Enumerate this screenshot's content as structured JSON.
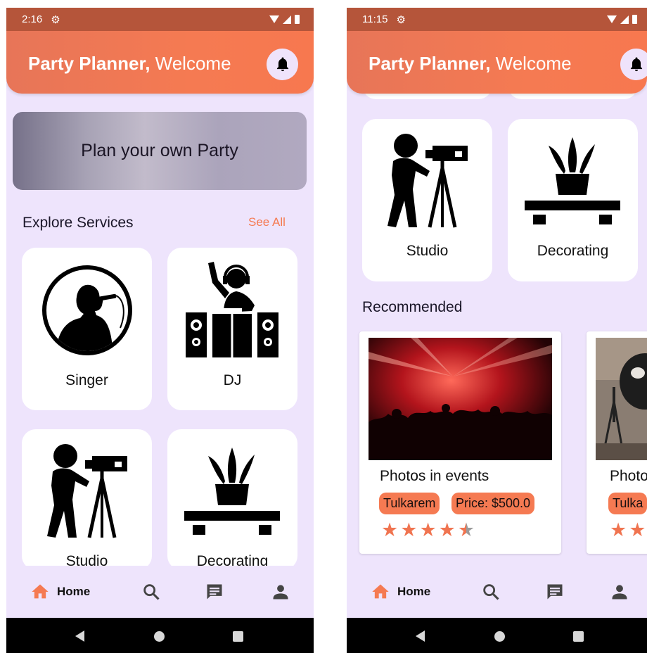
{
  "left": {
    "status": {
      "time": "2:16"
    },
    "header": {
      "app_name": "Party Planner,",
      "welcome": "Welcome"
    },
    "banner": {
      "text": "Plan your own Party"
    },
    "explore": {
      "title": "Explore Services",
      "see_all": "See All"
    },
    "services": [
      {
        "label": "Singer",
        "icon": "singer-icon"
      },
      {
        "label": "DJ",
        "icon": "dj-icon"
      },
      {
        "label": "Studio",
        "icon": "camera-tripod-icon"
      },
      {
        "label": "Decorating",
        "icon": "plant-decor-icon"
      }
    ],
    "nav": {
      "home": "Home"
    }
  },
  "right": {
    "status": {
      "time": "11:15"
    },
    "header": {
      "app_name": "Party Planner,",
      "welcome": "Welcome"
    },
    "services": [
      {
        "label": "Studio",
        "icon": "camera-tripod-icon"
      },
      {
        "label": "Decorating",
        "icon": "plant-decor-icon"
      }
    ],
    "recommended": {
      "title": "Recommended",
      "items": [
        {
          "title": "Photos in events",
          "location": "Tulkarem",
          "price": "Price: $500.0",
          "rating": 4.5
        },
        {
          "title": "Photo",
          "location": "Tulka",
          "price": "",
          "rating": 2
        }
      ]
    },
    "nav": {
      "home": "Home"
    }
  },
  "colors": {
    "accent": "#f57a52",
    "status_bar": "#b5553a",
    "background": "#eee4fc",
    "star": "#f07450"
  }
}
